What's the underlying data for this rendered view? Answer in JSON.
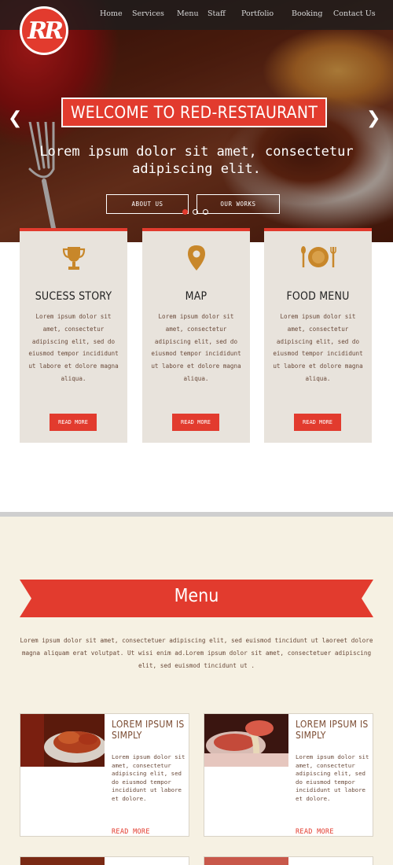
{
  "brand": {
    "logo_text": "RR",
    "accent": "#e23b2e"
  },
  "nav": {
    "items": [
      "Home",
      "Services",
      "Menu",
      "Staff",
      "Portfolio",
      "Booking",
      "Contact Us"
    ]
  },
  "hero": {
    "title": "WELCOME TO RED-RESTAURANT",
    "tagline_line1": "Lorem ipsum dolor sit amet, consectetur",
    "tagline_line2": "adipiscing elit.",
    "btn_about": "ABOUT US",
    "btn_works": "OUR WORKS",
    "prev_icon": "chevron-left-icon",
    "next_icon": "chevron-right-icon"
  },
  "features": [
    {
      "icon": "trophy-icon",
      "title": "SUCESS STORY",
      "text": "Lorem ipsum dolor sit amet, consectetur adipiscing elit, sed do eiusmod tempor incididunt ut labore et dolore magna aliqua.",
      "button": "READ MORE"
    },
    {
      "icon": "map-pin-icon",
      "title": "MAP",
      "text": "Lorem ipsum dolor sit amet, consectetur adipiscing elit, sed do eiusmod tempor incididunt ut labore et dolore magna aliqua.",
      "button": "READ MORE"
    },
    {
      "icon": "plate-cutlery-icon",
      "title": "FOOD MENU",
      "text": "Lorem ipsum dolor sit amet, consectetur adipiscing elit, sed do eiusmod tempor incididunt ut labore et dolore magna aliqua.",
      "button": "READ MORE"
    }
  ],
  "menu": {
    "heading": "Menu",
    "intro": "Lorem ipsum dolor sit amet, consectetuer adipiscing elit, sed euismod tincidunt ut laoreet dolore magna aliquam erat volutpat. Ut wisi enim ad.Lorem ipsum dolor sit amet, consectetuer adipiscing elit, sed euismod tincidunt ut .",
    "items": [
      {
        "title": "LOREM IPSUM IS SIMPLY",
        "text": "Lorem ipsum dolor sit amet, consectetur adipiscing elit, sed do eiusmod tempor incididunt ut labore et dolore.",
        "more": "READ MORE"
      },
      {
        "title": "LOREM IPSUM IS SIMPLY",
        "text": "Lorem ipsum dolor sit amet, consectetur adipiscing elit, sed do eiusmod tempor incididunt ut labore et dolore.",
        "more": "READ MORE"
      }
    ]
  }
}
